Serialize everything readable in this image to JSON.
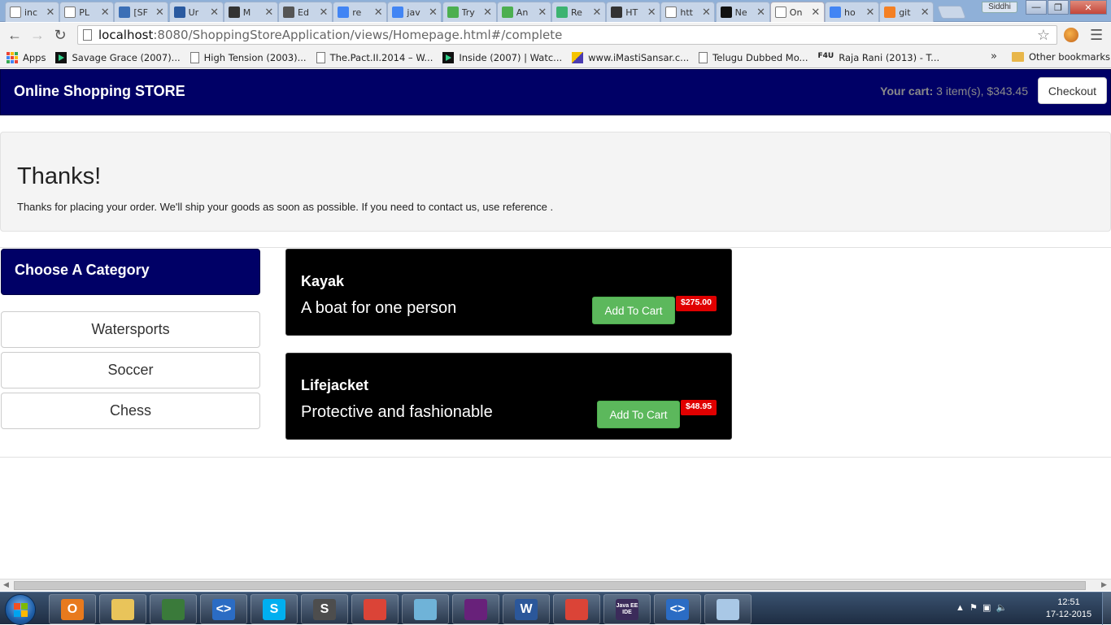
{
  "browser": {
    "tabs": [
      {
        "title": "inc",
        "icon": "page-icon",
        "color": "#ffffff"
      },
      {
        "title": "PL",
        "icon": "page-icon",
        "color": "#ffffff"
      },
      {
        "title": "[SF",
        "icon": "sf-icon",
        "color": "#3b6fb6"
      },
      {
        "title": "Ur",
        "icon": "tools-icon",
        "color": "#2a5aa0"
      },
      {
        "title": "M",
        "icon": "m-icon",
        "color": "#333333"
      },
      {
        "title": "Ed",
        "icon": "cloud-icon",
        "color": "#555555"
      },
      {
        "title": "re",
        "icon": "google-icon",
        "color": "#4285f4"
      },
      {
        "title": "jav",
        "icon": "google-icon",
        "color": "#4285f4"
      },
      {
        "title": "Try",
        "icon": "w3-icon",
        "color": "#4caf50"
      },
      {
        "title": "An",
        "icon": "w3-icon",
        "color": "#4caf50"
      },
      {
        "title": "Re",
        "icon": "gear-icon",
        "color": "#3cb371"
      },
      {
        "title": "HT",
        "icon": "codepen-icon",
        "color": "#333333"
      },
      {
        "title": "htt",
        "icon": "page-icon",
        "color": "#ffffff"
      },
      {
        "title": "Ne",
        "icon": "github-icon",
        "color": "#111111"
      },
      {
        "title": "On",
        "icon": "page-icon",
        "color": "#ffffff",
        "active": true
      },
      {
        "title": "ho",
        "icon": "google-icon",
        "color": "#4285f4"
      },
      {
        "title": "git",
        "icon": "stack-icon",
        "color": "#f48024"
      }
    ],
    "profile_name": "Siddhi",
    "url_host": "localhost",
    "url_path": ":8080/ShoppingStoreApplication/views/Homepage.html#/complete",
    "bookmarks": [
      {
        "label": "Apps",
        "icon": "apps"
      },
      {
        "label": "Savage Grace (2007)...",
        "icon": "play"
      },
      {
        "label": "High Tension (2003)...",
        "icon": "page"
      },
      {
        "label": "The.Pact.II.2014 – W...",
        "icon": "page"
      },
      {
        "label": "Inside (2007) | Watc...",
        "icon": "play"
      },
      {
        "label": "www.iMastiSansar.c...",
        "icon": "imasti"
      },
      {
        "label": "Telugu Dubbed Mo...",
        "icon": "page"
      },
      {
        "label": "Raja Rani (2013) - T...",
        "icon": "f4u"
      }
    ],
    "bookmarks_overflow": "»",
    "other_bookmarks": "Other bookmarks"
  },
  "store": {
    "brand": "Online Shopping STORE",
    "cart_label": "Your cart:",
    "cart_summary": "3 item(s), $343.45",
    "checkout_label": "Checkout",
    "thanks_title": "Thanks!",
    "thanks_text": "Thanks for placing your order. We'll ship your goods as soon as possible. If you need to contact us, use reference .",
    "category_heading": "Choose A Category",
    "categories": [
      "Watersports",
      "Soccer",
      "Chess"
    ],
    "products": [
      {
        "name": "Kayak",
        "description": "A boat for one person",
        "add_label": "Add To Cart",
        "price": "$275.00"
      },
      {
        "name": "Lifejacket",
        "description": "Protective and fashionable",
        "add_label": "Add To Cart",
        "price": "$48.95"
      }
    ]
  },
  "taskbar": {
    "apps": [
      {
        "name": "outlook-icon",
        "glyph": "O",
        "color": "#e87a1d"
      },
      {
        "name": "explorer-icon",
        "glyph": "",
        "color": "#e9c45a"
      },
      {
        "name": "spreadsheet-icon",
        "glyph": "",
        "color": "#3a7a3a"
      },
      {
        "name": "code-editor-icon",
        "glyph": "<>",
        "color": "#2b6cc4"
      },
      {
        "name": "skype-icon",
        "glyph": "S",
        "color": "#00aff0"
      },
      {
        "name": "sublime-icon",
        "glyph": "S",
        "color": "#4d4d4d"
      },
      {
        "name": "chrome-icon",
        "glyph": "",
        "color": "#db4437"
      },
      {
        "name": "sketch-icon",
        "glyph": "",
        "color": "#6fb3d8"
      },
      {
        "name": "visual-studio-icon",
        "glyph": "",
        "color": "#68217a"
      },
      {
        "name": "word-icon",
        "glyph": "W",
        "color": "#2b579a"
      },
      {
        "name": "chrome-icon",
        "glyph": "",
        "color": "#db4437"
      },
      {
        "name": "java-ee-ide-icon",
        "glyph": "Java EE IDE",
        "color": "#3b2b5a"
      },
      {
        "name": "code-editor-icon",
        "glyph": "<>",
        "color": "#2b6cc4"
      },
      {
        "name": "paint-icon",
        "glyph": "",
        "color": "#a9c8e6"
      }
    ],
    "time": "12:51",
    "date": "17-12-2015"
  }
}
